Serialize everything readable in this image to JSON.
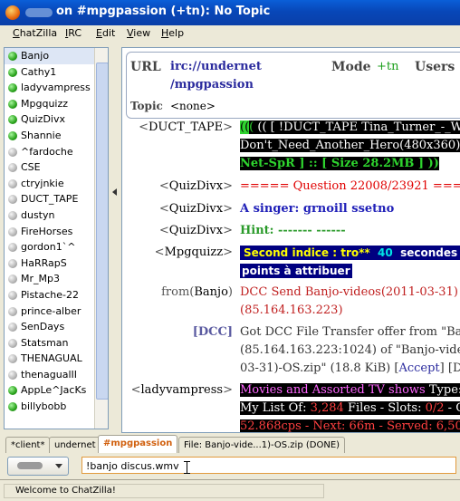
{
  "window": {
    "title": "on #mpgpassion (+tn): No Topic"
  },
  "menu": [
    {
      "pre": "",
      "u": "C",
      "post": "hatZilla"
    },
    {
      "pre": "",
      "u": "I",
      "post": "RC"
    },
    {
      "pre": "",
      "u": "E",
      "post": "dit"
    },
    {
      "pre": "",
      "u": "V",
      "post": "iew"
    },
    {
      "pre": "",
      "u": "H",
      "post": "elp"
    }
  ],
  "users": [
    {
      "name": "Banjo",
      "op": true
    },
    {
      "name": "Cathy1",
      "op": true
    },
    {
      "name": "ladyvampress",
      "op": true
    },
    {
      "name": "Mpgquizz",
      "op": true
    },
    {
      "name": "QuizDivx",
      "op": true
    },
    {
      "name": "Shannie",
      "op": true
    },
    {
      "name": "^fardoche",
      "op": false
    },
    {
      "name": "CSE",
      "op": false
    },
    {
      "name": "ctryjnkie",
      "op": false
    },
    {
      "name": "DUCT_TAPE",
      "op": false
    },
    {
      "name": "dustyn",
      "op": false
    },
    {
      "name": "FireHorses",
      "op": false
    },
    {
      "name": "gordon1`^",
      "op": false
    },
    {
      "name": "HaRRapS",
      "op": false
    },
    {
      "name": "Mr_Mp3",
      "op": false
    },
    {
      "name": "Pistache-22",
      "op": false
    },
    {
      "name": "prince-alber",
      "op": false
    },
    {
      "name": "SenDays",
      "op": false
    },
    {
      "name": "Statsman",
      "op": false
    },
    {
      "name": "THENAGUAL",
      "op": false
    },
    {
      "name": "thenagualII",
      "op": false
    },
    {
      "name": "AppLe^JacKs",
      "op": true
    },
    {
      "name": "billybobb",
      "op": true
    }
  ],
  "channel": {
    "url_label": "URL",
    "url_line1": "irc://undernet",
    "url_line2": "/mpgpassion",
    "mode_label": "Mode",
    "mode_value": "+tn",
    "users_label": "Users",
    "topic_label": "Topic",
    "topic_value": "<none>"
  },
  "messages": {
    "m1_nick": "DUCT_TAPE",
    "m1_l1": "(( [ !DUCT_TAPE Tina_Turner_-_W",
    "m1_l2": "Don't_Need_Another_Hero(480x360).r",
    "m1_l3a": "Net-SpR",
    "m1_l3b": " ] :: [ Size ",
    "m1_l3c": "28.2MB",
    "m1_l3d": " ] ))",
    "m2_nick": "QuizDivx",
    "m2_text": "===== Question 22008/23921 =====",
    "m3_nick": "QuizDivx",
    "m3_text": "A singer: grnoill ssetno",
    "m4_nick": "QuizDivx",
    "m4_text": "Hint: ------- ------",
    "m5_nick": "Mpgquizz",
    "m5_l1a": "Second indice : tro**",
    "m5_l1b": "40",
    "m5_l1c": "secondes o",
    "m5_l2": "points à attribuer",
    "m6_from": "from",
    "m6_nick": "Banjo",
    "m6_l1": "DCC Send Banjo-videos(2011-03-31)",
    "m6_l2": "(85.164.163.223)",
    "m7_nick": "[DCC]",
    "m7_l1": "Got DCC File Transfer offer from \"Banj",
    "m7_l2": "(85.164.163.223:1024) of \"Banjo-video",
    "m7_l3a": "03-31)-OS.zip\" (18.8 KiB) [",
    "m7_accept": "Accept",
    "m7_l3b": "] [D",
    "m8_nick": "ladyvampress",
    "m8_l1a": "Movies and Assorted TV shows",
    "m8_l1b": "Type: (",
    "m8_l2a": "My List Of: ",
    "m8_l2b": "3,284",
    "m8_l2c": " Files - Slots: ",
    "m8_l2d": "0/2",
    "m8_l2e": " - Queue",
    "m8_l3": "52.868cps - Next: 66m - Served: 6,503"
  },
  "tabs": [
    {
      "label": "*client*"
    },
    {
      "label": "undernet"
    },
    {
      "label": "#mpgpassion"
    },
    {
      "label": "File: Banjo-vide...1)-OS.zip (DONE)"
    }
  ],
  "input": {
    "value": "!banjo discus.wmv"
  },
  "status": {
    "text": "Welcome to ChatZilla!"
  },
  "colors": {
    "accent_tab": "#d1600e",
    "op_dot": "#2aa31c",
    "title_blue": "#0a5fd8"
  }
}
